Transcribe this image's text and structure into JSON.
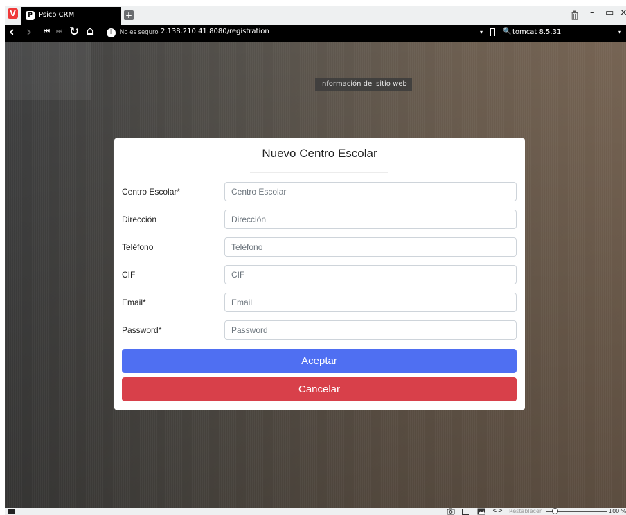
{
  "browser": {
    "logo_glyph": "V",
    "tab": {
      "title": "Psico CRM",
      "favicon": "P"
    },
    "new_tab_glyph": "+",
    "window_controls": {
      "minimize": "–",
      "restore": "▭",
      "close": "×"
    },
    "nav": {
      "back": "‹",
      "forward": "›",
      "rewind": "⏮",
      "fastforward": "⏭",
      "reload": "↻",
      "home": "⌂"
    },
    "address": {
      "security_glyph": "i",
      "security_text": "No es seguro",
      "url": "2.138.210.41:8080/registration",
      "dropdown_glyph": "▾"
    },
    "search": {
      "icon_glyph": "🔍",
      "value": "tomcat 8.5.31",
      "dropdown_glyph": "▾"
    },
    "tooltip": "Información del sitio web"
  },
  "modal": {
    "title": "Nuevo Centro Escolar",
    "fields": [
      {
        "label": "Centro Escolar*",
        "placeholder": "Centro Escolar"
      },
      {
        "label": "Dirección",
        "placeholder": "Dirección"
      },
      {
        "label": "Teléfono",
        "placeholder": "Teléfono"
      },
      {
        "label": "CIF",
        "placeholder": "CIF"
      },
      {
        "label": "Email*",
        "placeholder": "Email"
      },
      {
        "label": "Password*",
        "placeholder": "Password"
      }
    ],
    "accept_label": "Aceptar",
    "cancel_label": "Cancelar"
  },
  "statusbar": {
    "reset_label": "Restablecer",
    "zoom_value": "100 %"
  },
  "colors": {
    "accept": "#4f6ff2",
    "cancel": "#d8404a",
    "vivaldi_red": "#ef3939"
  }
}
